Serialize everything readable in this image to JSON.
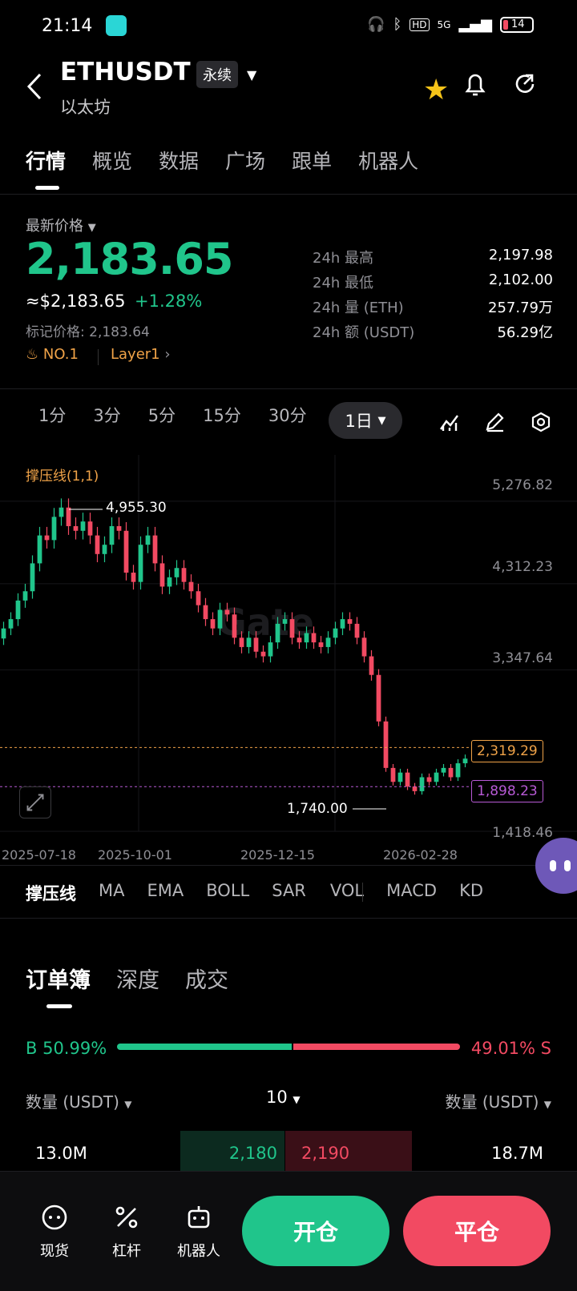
{
  "status_bar": {
    "time": "21:14",
    "battery": "14",
    "network": "5G"
  },
  "header": {
    "pair": "ETHUSDT",
    "contract_type": "永续",
    "subtitle": "以太坊"
  },
  "main_tabs": [
    "行情",
    "概览",
    "数据",
    "广场",
    "跟单",
    "机器人"
  ],
  "price": {
    "label": "最新价格",
    "last": "2,183.65",
    "usd": "≈$2,183.65",
    "change": "+1.28%",
    "mark_label": "标记价格:",
    "mark": "2,183.64",
    "rank": "NO.1",
    "sector": "Layer1"
  },
  "stats": [
    {
      "label": "24h  最高",
      "value": "2,197.98"
    },
    {
      "label": "24h  最低",
      "value": "2,102.00"
    },
    {
      "label": "24h  量 (ETH)",
      "value": "257.79万"
    },
    {
      "label": "24h  额 (USDT)",
      "value": "56.29亿"
    }
  ],
  "intervals": [
    "1分",
    "3分",
    "5分",
    "15分",
    "30分"
  ],
  "interval_active": "1日",
  "chart_data": {
    "type": "candlestick",
    "indicator_label": "撑压线(1,1)",
    "watermark": "Gate",
    "y_ticks": [
      "5,276.82",
      "4,312.23",
      "3,347.64",
      "1,418.46"
    ],
    "x_ticks": [
      "2025-07-18",
      "2025-10-01",
      "2025-12-15",
      "2026-02-28"
    ],
    "ylim": [
      1418.46,
      5276.82
    ],
    "high_annotation": "4,955.30",
    "low_annotation": "1,740.00",
    "resistance": "2,319.29",
    "support": "1,898.23",
    "resistance_value": 2319.29,
    "support_value": 1898.23,
    "close_series": [
      3600,
      3700,
      3900,
      4000,
      4300,
      4600,
      4550,
      4800,
      4900,
      4700,
      4650,
      4750,
      4600,
      4400,
      4500,
      4700,
      4650,
      4200,
      4100,
      4500,
      4600,
      4300,
      4050,
      4150,
      4250,
      4100,
      4000,
      3850,
      3700,
      3600,
      3800,
      3750,
      3500,
      3400,
      3500,
      3350,
      3300,
      3450,
      3650,
      3700,
      3500,
      3450,
      3550,
      3450,
      3400,
      3500,
      3600,
      3700,
      3650,
      3500,
      3300,
      3100,
      2600,
      2100,
      1950,
      2050,
      1900,
      1850,
      2000,
      1950,
      2050,
      2100,
      2000,
      2150,
      2200
    ]
  },
  "indicator_tabs": [
    "撑压线",
    "MA",
    "EMA",
    "BOLL",
    "SAR",
    "VOL",
    "MACD",
    "KD"
  ],
  "orderbook": {
    "tabs": [
      "订单簿",
      "深度",
      "成交"
    ],
    "buy_ratio": "B 50.99%",
    "sell_ratio": "49.01% S",
    "buy_ratio_value": 50.99,
    "qty_header": "数量 (USDT)",
    "depth": "10",
    "bid_qty": "13.0M",
    "bid_price": "2,180",
    "ask_price": "2,190",
    "ask_qty": "18.7M"
  },
  "bottom_nav": [
    "现货",
    "杠杆",
    "机器人"
  ],
  "actions": {
    "open": "开仓",
    "close": "平仓"
  }
}
